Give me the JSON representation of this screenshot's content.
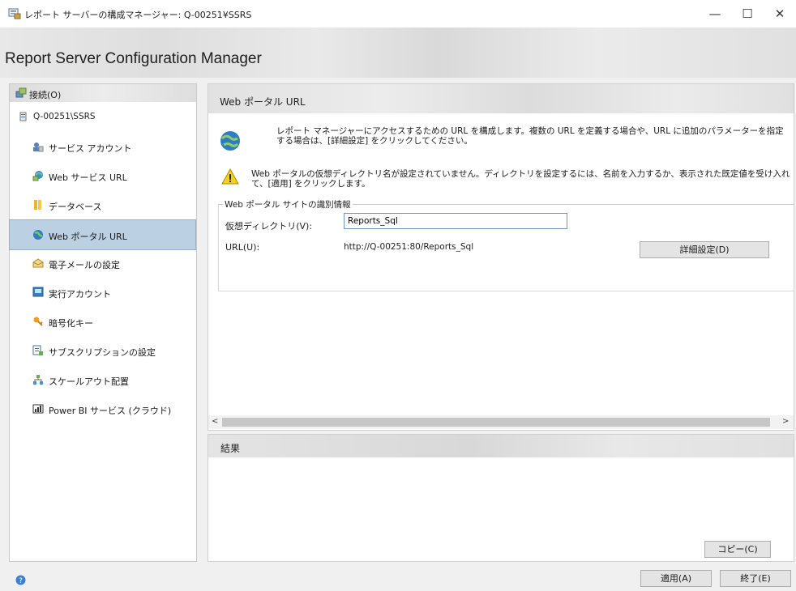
{
  "window": {
    "title": "レポート サーバーの構成マネージャー: Q-00251¥SSRS",
    "minimize_glyph": "—",
    "maximize_glyph": "☐",
    "close_glyph": "✕"
  },
  "banner": {
    "title": "Report Server Configuration Manager"
  },
  "sidebar": {
    "connect_label": "接続(O)",
    "server_name": "Q-00251\\SSRS",
    "items": [
      {
        "label": "サービス アカウント",
        "icon": "service-account-icon",
        "selected": false
      },
      {
        "label": "Web サービス URL",
        "icon": "web-service-icon",
        "selected": false
      },
      {
        "label": "データベース",
        "icon": "database-icon",
        "selected": false
      },
      {
        "label": "Web ポータル URL",
        "icon": "globe-icon",
        "selected": true
      },
      {
        "label": "電子メールの設定",
        "icon": "email-icon",
        "selected": false
      },
      {
        "label": "実行アカウント",
        "icon": "execution-account-icon",
        "selected": false
      },
      {
        "label": "暗号化キー",
        "icon": "key-icon",
        "selected": false
      },
      {
        "label": "サブスクリプションの設定",
        "icon": "subscription-icon",
        "selected": false
      },
      {
        "label": "スケールアウト配置",
        "icon": "scaleout-icon",
        "selected": false
      },
      {
        "label": "Power BI サービス (クラウド)",
        "icon": "powerbi-icon",
        "selected": false
      }
    ]
  },
  "main": {
    "title": "Web ポータル URL",
    "intro": "レポート マネージャーにアクセスするための URL を構成します。複数の URL を定義する場合や、URL に追加のパラメーターを指定する場合は、[詳細設定] をクリックしてください。",
    "warning": {
      "line1": "Web ポータルの仮想ディレクトリ名が設定されていません。ディレクトリを設定するには、名前を入力するか、表示された既定値を受け入れ",
      "line2": "て、[適用] をクリックします。"
    },
    "group_label": "Web ポータル サイトの識別情報",
    "vdir_label": "仮想ディレクトリ(V):",
    "vdir_value": "Reports_Sql",
    "url_label": "URL(U):",
    "url_value": "http://Q-00251:80/Reports_Sql",
    "advanced_button": "詳細設定(D)"
  },
  "results": {
    "title": "結果",
    "copy_button": "コピー(C)"
  },
  "footer": {
    "apply_button": "適用(A)",
    "exit_button": "終了(E)"
  }
}
